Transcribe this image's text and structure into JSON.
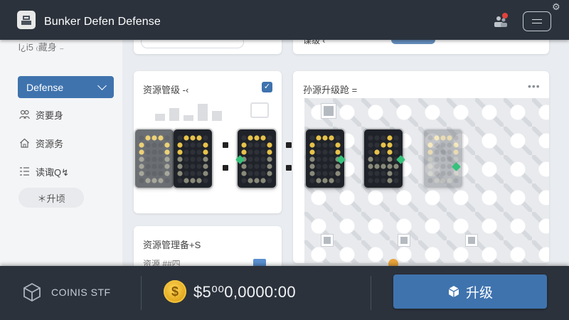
{
  "header": {
    "title": "Bunker Defen Defense",
    "logo_icon": "bunker-logo-icon",
    "users_icon": "users-icon",
    "menu_icon": "hamburger-menu-icon",
    "settings_icon": "gear-icon"
  },
  "sidebar": {
    "heading": "l¿i5 ₍藏身 ₋",
    "dropdown_value": "Defense",
    "items": [
      {
        "label": "资要身",
        "icon": "people-icon"
      },
      {
        "label": "资源务",
        "icon": "home-icon"
      },
      {
        "label": "读诹Q↯",
        "icon": "list-icon"
      }
    ],
    "pill_label": "＊升顷"
  },
  "panels": {
    "top_left_title": "资源管级 -‹",
    "top_right_title": "孙源升级跄 =",
    "bottom_left_title": "资源管理备+S",
    "bottom_left_sub": "资源  ##四",
    "top_strip_right": "谍级 ‹"
  },
  "timer": {
    "digits": [
      "0",
      "0",
      "0",
      "0",
      "4"
    ],
    "separator": ":"
  },
  "footer": {
    "coins_label": "COINIS STF",
    "coins_icon": "cube-icon",
    "coin_icon": "gold-coin-icon",
    "coin_symbol": "$",
    "balance": "$5⁰⁰0,0000:00",
    "upgrade_label": "升级",
    "upgrade_icon": "cube-upgrade-icon"
  },
  "colors": {
    "bar_bg": "#2b323c",
    "accent": "#3f73ae",
    "led_on": "#e8c24a",
    "led_dim": "#8a8a7a",
    "indicator": "#35c27a"
  }
}
